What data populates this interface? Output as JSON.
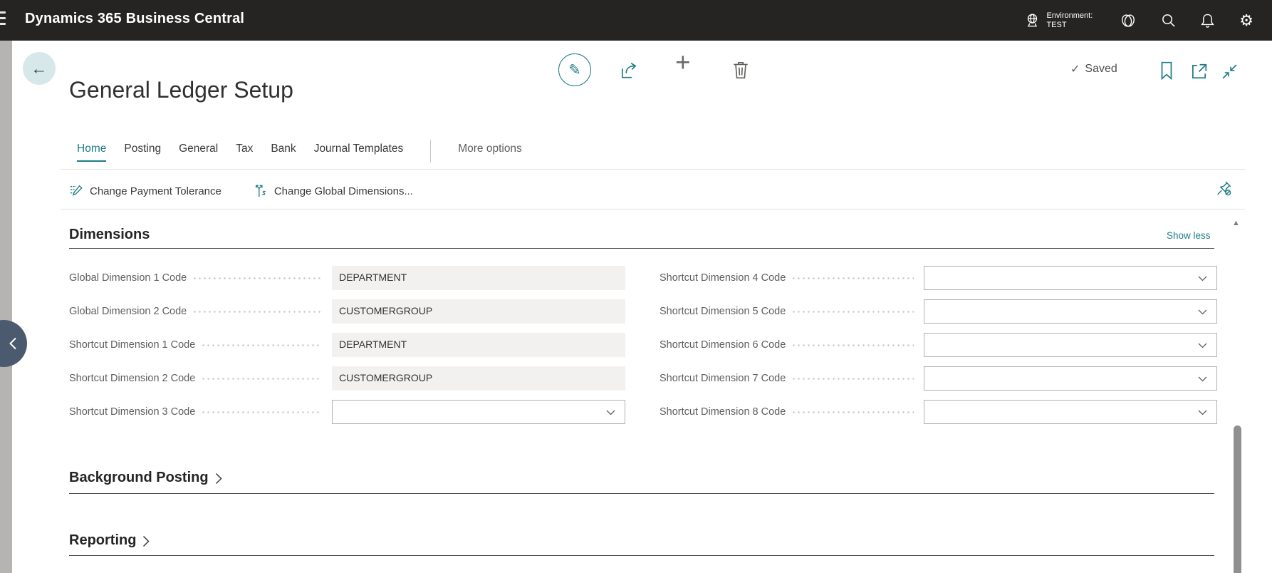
{
  "topbar": {
    "app_title": "Dynamics 365 Business Central",
    "environment_label": "Environment:",
    "environment_name": "TEST"
  },
  "icons": {
    "back_arrow": "←",
    "pencil": "✎",
    "plus": "+",
    "check": "✓",
    "gear": "⚙",
    "scroll_up": "▲"
  },
  "command_bar": {
    "saved_label": "Saved"
  },
  "page": {
    "title": "General Ledger Setup"
  },
  "nav": {
    "tabs": [
      "Home",
      "Posting",
      "General",
      "Tax",
      "Bank",
      "Journal Templates"
    ],
    "active_tab": "Home",
    "more_options": "More options"
  },
  "actions": {
    "change_payment_tolerance": "Change Payment Tolerance",
    "change_global_dimensions": "Change Global Dimensions..."
  },
  "dimensions": {
    "title": "Dimensions",
    "show_less": "Show less",
    "left_fields": [
      {
        "label": "Global Dimension 1 Code",
        "value": "DEPARTMENT",
        "type": "readonly"
      },
      {
        "label": "Global Dimension 2 Code",
        "value": "CUSTOMERGROUP",
        "type": "readonly"
      },
      {
        "label": "Shortcut Dimension 1 Code",
        "value": "DEPARTMENT",
        "type": "readonly"
      },
      {
        "label": "Shortcut Dimension 2 Code",
        "value": "CUSTOMERGROUP",
        "type": "readonly"
      },
      {
        "label": "Shortcut Dimension 3 Code",
        "value": "",
        "type": "combobox"
      }
    ],
    "right_fields": [
      {
        "label": "Shortcut Dimension 4 Code",
        "value": "",
        "type": "combobox"
      },
      {
        "label": "Shortcut Dimension 5 Code",
        "value": "",
        "type": "combobox"
      },
      {
        "label": "Shortcut Dimension 6 Code",
        "value": "",
        "type": "combobox"
      },
      {
        "label": "Shortcut Dimension 7 Code",
        "value": "",
        "type": "combobox"
      },
      {
        "label": "Shortcut Dimension 8 Code",
        "value": "",
        "type": "combobox"
      }
    ]
  },
  "collapsed_sections": [
    {
      "title": "Background Posting"
    },
    {
      "title": "Reporting"
    }
  ],
  "colors": {
    "accent_teal": "#1f7c85",
    "topbar_bg": "#262422",
    "readonly_field_bg": "#f2f1f0",
    "nav_circle": "#4b5a6e"
  }
}
